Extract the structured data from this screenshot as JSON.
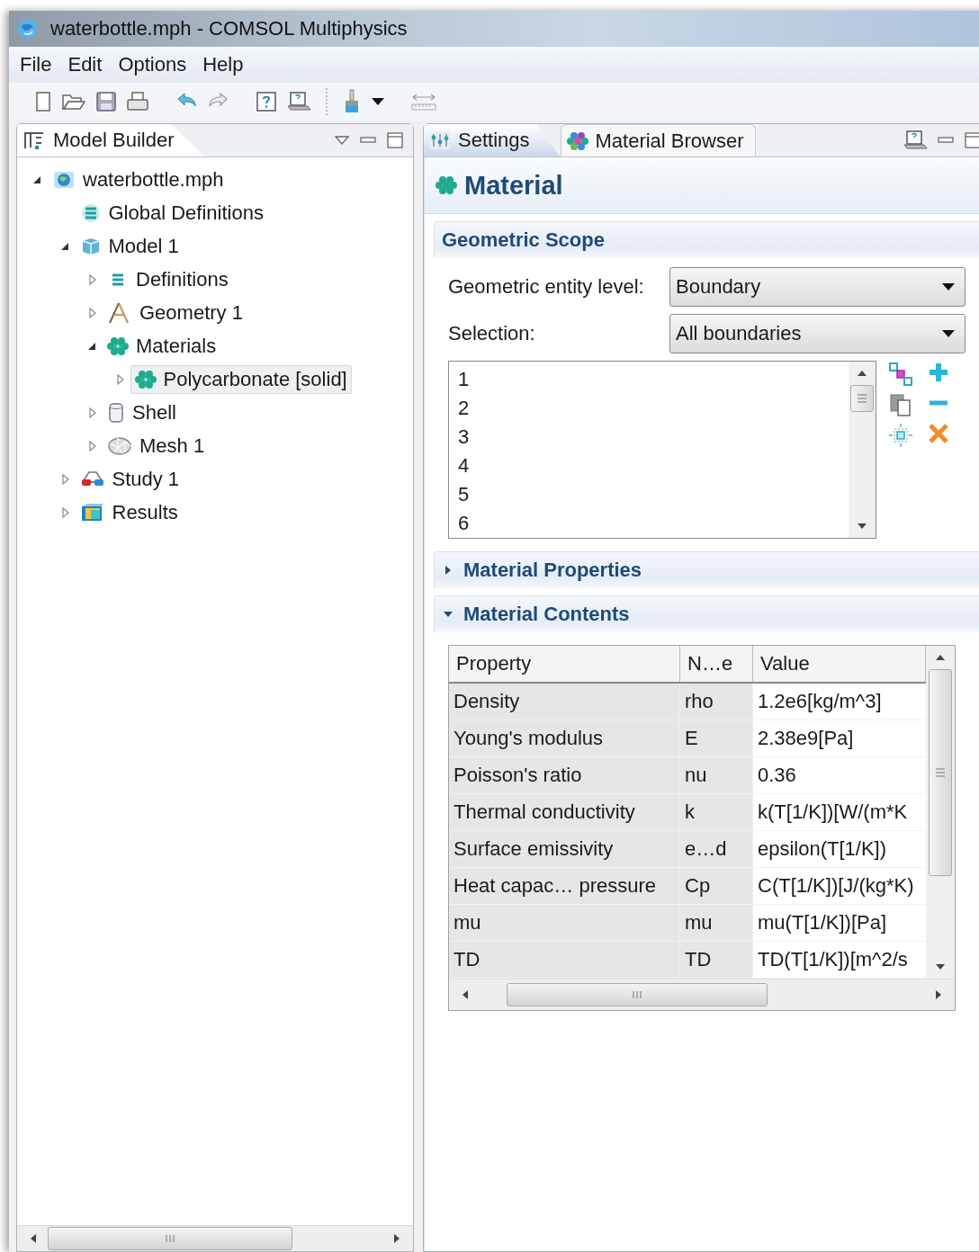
{
  "window": {
    "title": "waterbottle.mph - COMSOL Multiphysics"
  },
  "menu": [
    "File",
    "Edit",
    "Options",
    "Help"
  ],
  "left_panel": {
    "tab": "Model Builder",
    "tree": [
      {
        "label": "waterbottle.mph",
        "kind": "file",
        "expanded": true,
        "selected": false,
        "children": [
          {
            "label": "Global Definitions",
            "kind": "global",
            "selected": false
          },
          {
            "label": "Model 1",
            "kind": "model",
            "expanded": true,
            "selected": false,
            "children": [
              {
                "label": "Definitions",
                "kind": "definitions",
                "expanded": false,
                "selected": false
              },
              {
                "label": "Geometry 1",
                "kind": "geometry",
                "expanded": false,
                "selected": false
              },
              {
                "label": "Materials",
                "kind": "materials",
                "expanded": true,
                "selected": false,
                "children": [
                  {
                    "label": "Polycarbonate [solid]",
                    "kind": "materials",
                    "expanded": false,
                    "selected": true
                  }
                ]
              },
              {
                "label": "Shell",
                "kind": "shell",
                "expanded": false,
                "selected": false
              },
              {
                "label": "Mesh 1",
                "kind": "mesh",
                "expanded": false,
                "selected": false
              }
            ]
          },
          {
            "label": "Study 1",
            "kind": "study",
            "expanded": false,
            "selected": false
          },
          {
            "label": "Results",
            "kind": "results",
            "expanded": false,
            "selected": false
          }
        ]
      }
    ]
  },
  "right_panel": {
    "tabs": [
      {
        "label": "Settings",
        "kind": "settings",
        "selected": true
      },
      {
        "label": "Material Browser",
        "kind": "materials",
        "selected": false
      }
    ],
    "heading": "Material",
    "geometric_scope": {
      "title": "Geometric Scope",
      "fields": [
        {
          "label": "Geometric entity level:",
          "value": "Boundary"
        },
        {
          "label": "Selection:",
          "value": "All boundaries"
        }
      ],
      "selection": [
        "1",
        "2",
        "3",
        "4",
        "5",
        "6"
      ]
    },
    "material_properties": {
      "title": "Material Properties",
      "expanded": false
    },
    "material_contents": {
      "title": "Material Contents",
      "expanded": true,
      "table": {
        "columns": [
          "Property",
          "N…e",
          "Value"
        ],
        "rows": [
          [
            "Density",
            "rho",
            "1.2e6[kg/m^3]"
          ],
          [
            "Young's modulus",
            "E",
            "2.38e9[Pa]"
          ],
          [
            "Poisson's ratio",
            "nu",
            "0.36"
          ],
          [
            "Thermal conductivity",
            "k",
            "k(T[1/K])[W/(m*K"
          ],
          [
            "Surface emissivity",
            "e…d",
            "epsilon(T[1/K])"
          ],
          [
            "Heat capac… pressure",
            "Cp",
            "C(T[1/K])[J/(kg*K)"
          ],
          [
            "mu",
            "mu",
            "mu(T[1/K])[Pa]"
          ],
          [
            "TD",
            "TD",
            "TD(T[1/K])[m^2/s"
          ]
        ]
      }
    }
  }
}
